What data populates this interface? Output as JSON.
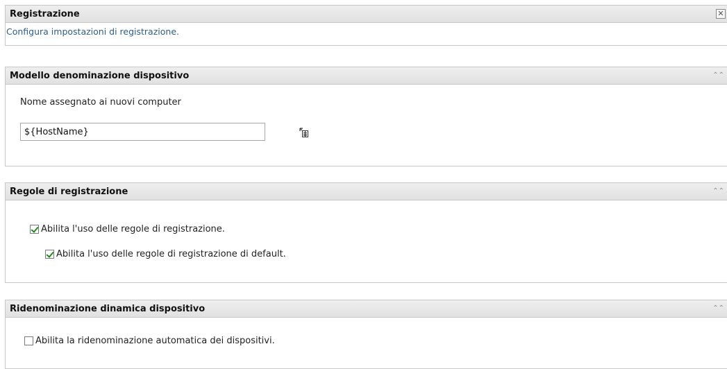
{
  "header": {
    "title": "Registrazione",
    "description": "Configura impostazioni di registrazione.",
    "close_label": "✕"
  },
  "naming": {
    "title": "Modello denominazione dispositivo",
    "field_label": "Nome assegnato ai nuovi computer",
    "field_value": "${HostName}",
    "collapse_icon": "double-chevron-up"
  },
  "rules": {
    "title": "Regole di registrazione",
    "enable_rules_label": "Abilita l'uso delle regole di registrazione.",
    "enable_rules_checked": true,
    "enable_default_rules_label": "Abilita l'uso delle regole di registrazione di default.",
    "enable_default_rules_checked": true,
    "collapse_icon": "double-chevron-up"
  },
  "rename": {
    "title": "Ridenominazione dinamica dispositivo",
    "enable_rename_label": "Abilita la ridenominazione automatica dei dispositivi.",
    "enable_rename_checked": false,
    "collapse_icon": "double-chevron-up"
  }
}
